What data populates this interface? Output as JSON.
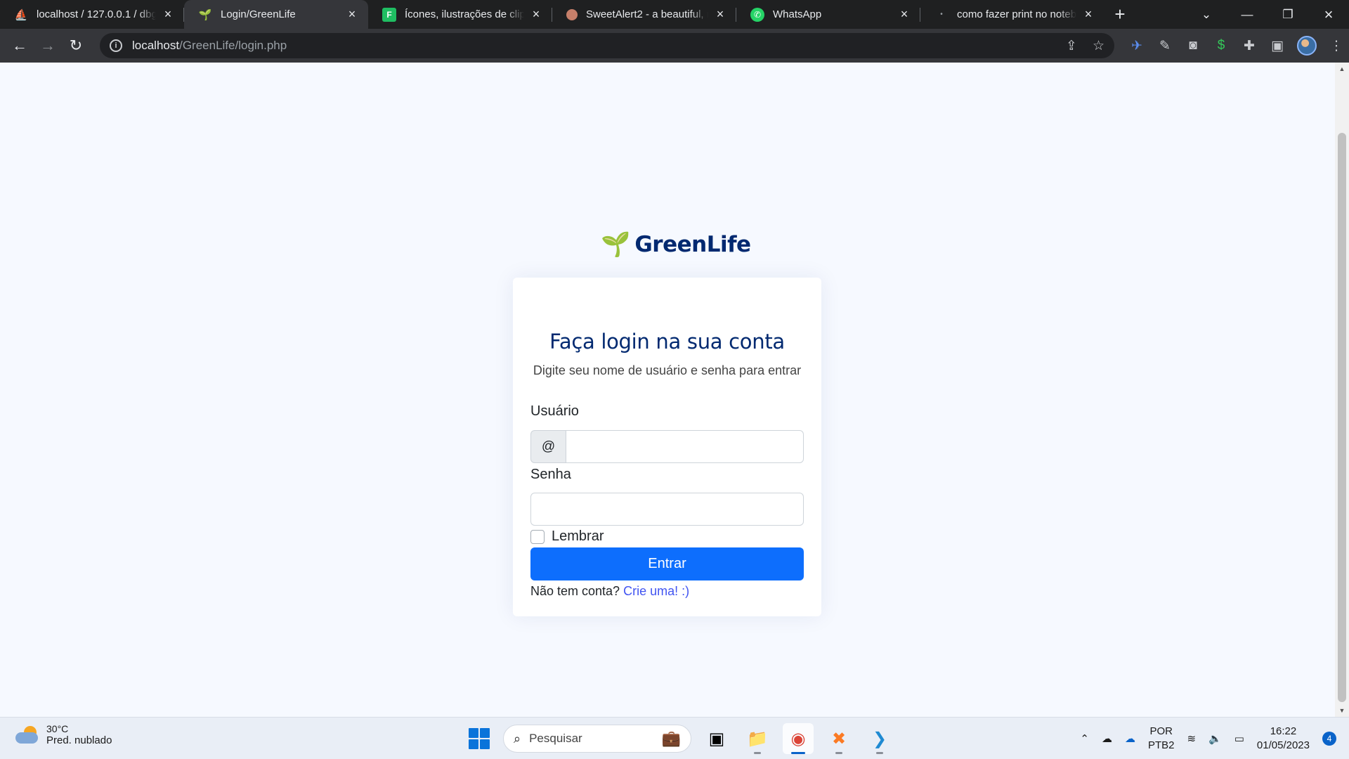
{
  "browser": {
    "tabs": [
      {
        "title": "localhost / 127.0.0.1 / dbgr",
        "favicon": "phpmyadmin-icon",
        "active": false
      },
      {
        "title": "Login/GreenLife",
        "favicon": "seedling-icon",
        "active": true
      },
      {
        "title": "Ícones, ilustrações de clipar",
        "favicon": "flaticon-icon",
        "active": false
      },
      {
        "title": "SweetAlert2 - a beautiful, re",
        "favicon": "sweetalert-icon",
        "active": false
      },
      {
        "title": "WhatsApp",
        "favicon": "whatsapp-icon",
        "active": false
      },
      {
        "title": "como fazer print no notebo",
        "favicon": "google-icon",
        "active": false
      }
    ],
    "url_host": "localhost",
    "url_path": "/GreenLife/login.php"
  },
  "page": {
    "brand": "GreenLife",
    "brand_icon": "🌱",
    "heading": "Faça login na sua conta",
    "subheading": "Digite seu nome de usuário e senha para entrar",
    "username_label": "Usuário",
    "username_prefix": "@",
    "username_value": "",
    "password_label": "Senha",
    "password_value": "",
    "remember_label": "Lembrar",
    "remember_checked": false,
    "submit_label": "Entrar",
    "signup_text": "Não tem conta?",
    "signup_link": "Crie uma! :)"
  },
  "taskbar": {
    "temperature": "30°C",
    "weather": "Pred. nublado",
    "search_placeholder": "Pesquisar",
    "lang_line1": "POR",
    "lang_line2": "PTB2",
    "time": "16:22",
    "date": "01/05/2023",
    "notifications": "4"
  },
  "colors": {
    "brand": "#012970",
    "primary_button": "#0d6efd",
    "link": "#4154f1",
    "page_background": "#f6f9ff"
  }
}
